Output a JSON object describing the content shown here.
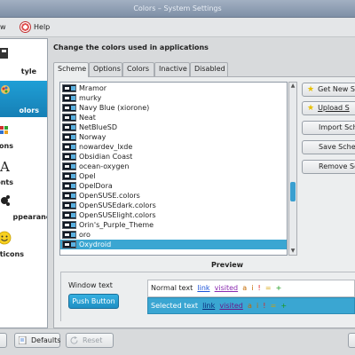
{
  "window": {
    "title": "Colors – System Settings"
  },
  "menubar": {
    "partial_label": "w",
    "help_label": "Help"
  },
  "sidebar": {
    "items": [
      {
        "label": "tyle",
        "icon": "style-icon",
        "selected": false
      },
      {
        "label": "olors",
        "icon": "colors-icon",
        "selected": true
      },
      {
        "label": "ons",
        "icon": "icons-icon",
        "selected": false
      },
      {
        "label": "onts",
        "icon": "fonts-icon",
        "selected": false
      },
      {
        "label": "ppearance",
        "icon": "appearance-icon",
        "selected": false
      },
      {
        "label": "ticons",
        "icon": "emoticons-icon",
        "selected": false
      }
    ]
  },
  "main": {
    "heading": "Change the colors used in applications",
    "tabs": [
      {
        "label": "Scheme",
        "active": true
      },
      {
        "label": "Options",
        "active": false
      },
      {
        "label": "Colors",
        "active": false
      },
      {
        "label": "Inactive",
        "active": false
      },
      {
        "label": "Disabled",
        "active": false
      }
    ],
    "schemes": [
      "Mramor",
      "murky",
      "Navy Blue (xiorone)",
      "Neat",
      "NetBlueSD",
      "Norway",
      "nowardev_lxde",
      "Obsidian Coast",
      "ocean-oxygen",
      "Opel",
      "OpelDora",
      "OpenSUSE.colors",
      "OpenSUSEdark.colors",
      "OpenSUSElight.colors",
      "Orin's_Purple_Theme",
      "oro",
      "Oxydroid"
    ],
    "selected_scheme": "Oxydroid",
    "buttons": {
      "get_new": "Get New S",
      "upload": "Upload S",
      "import": "Import Sch",
      "save": "Save Sche",
      "remove": "Remove Sc"
    },
    "preview": {
      "title": "Preview",
      "window_text": "Window text",
      "push_button": "Push Button",
      "normal_text": "Normal text",
      "selected_text": "Selected text",
      "link": "link",
      "visited": "visited",
      "a": "a",
      "i": "i",
      "neg": "!",
      "neu": "=",
      "pos": "+"
    }
  },
  "bottom": {
    "defaults": "Defaults",
    "reset": "Reset"
  },
  "colors": {
    "accent": "#1f9fd6",
    "selection": "#3aa6d2",
    "titlebar": "#8a9ab0"
  }
}
